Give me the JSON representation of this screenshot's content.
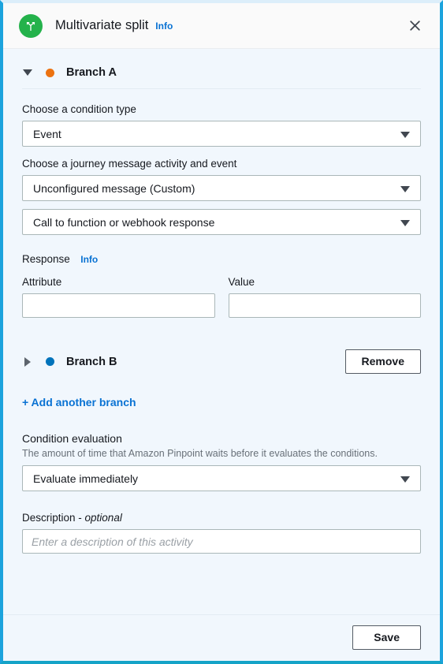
{
  "header": {
    "icon": "multivariate-split-icon",
    "icon_color": "#24b24b",
    "title": "Multivariate split",
    "info_label": "Info",
    "close_icon": "close-icon"
  },
  "branches": [
    {
      "caret": "chevron-down-icon",
      "dot_color": "#ec7211",
      "label": "Branch A",
      "expanded": true,
      "condition_type_label": "Choose a condition type",
      "condition_type_value": "Event",
      "activity_label": "Choose a journey message activity and event",
      "activity_value": "Unconfigured message (Custom)",
      "event_value": "Call to function or webhook response",
      "response_label": "Response",
      "response_info": "Info",
      "attribute_label": "Attribute",
      "attribute_value": "",
      "value_label": "Value",
      "value_value": ""
    },
    {
      "caret": "chevron-right-icon",
      "dot_color": "#0073bb",
      "label": "Branch B",
      "expanded": false,
      "remove_label": "Remove"
    }
  ],
  "add_branch_label": "+ Add another branch",
  "condition_evaluation": {
    "title": "Condition evaluation",
    "description": "The amount of time that Amazon Pinpoint waits before it evaluates the conditions.",
    "value": "Evaluate immediately"
  },
  "description_field": {
    "label": "Description - ",
    "optional": "optional",
    "value": "",
    "placeholder": "Enter a description of this activity"
  },
  "footer": {
    "save_label": "Save"
  }
}
